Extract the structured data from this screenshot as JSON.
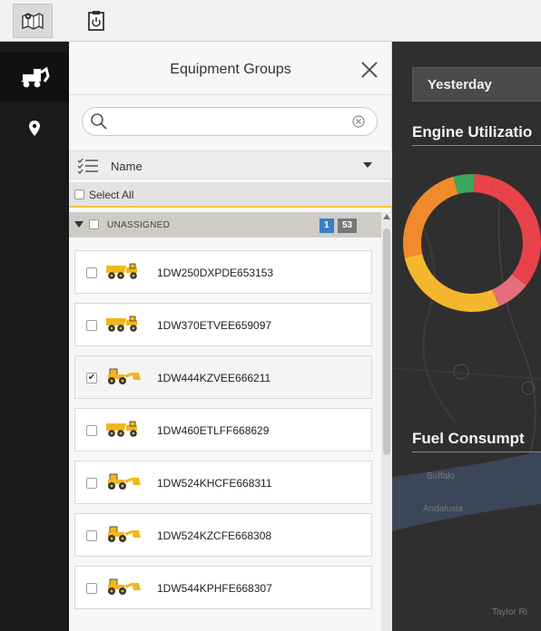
{
  "toolbar": {
    "items": [
      {
        "icon": "map-icon",
        "active": true
      },
      {
        "icon": "report-icon",
        "active": false
      }
    ]
  },
  "leftnav": {
    "items": [
      {
        "icon": "equipment-icon",
        "active": true
      },
      {
        "icon": "location-pin-icon",
        "active": false
      }
    ]
  },
  "panel": {
    "title": "Equipment Groups",
    "search": {
      "value": "",
      "placeholder": ""
    },
    "sort": {
      "label": "Name"
    },
    "select_all": {
      "label": "Select All"
    },
    "group": {
      "label": "UNASSIGNED",
      "selected_count": "1",
      "total_count": "53"
    },
    "items": [
      {
        "serial": "1DW250DXPDE653153",
        "checked": false,
        "icon": "dump-truck-icon"
      },
      {
        "serial": "1DW370ETVEE659097",
        "checked": false,
        "icon": "dump-truck-icon"
      },
      {
        "serial": "1DW444KZVEE666211",
        "checked": true,
        "icon": "wheel-loader-icon"
      },
      {
        "serial": "1DW460ETLFF668629",
        "checked": false,
        "icon": "dump-truck-icon"
      },
      {
        "serial": "1DW524KHCFE668311",
        "checked": false,
        "icon": "wheel-loader-icon"
      },
      {
        "serial": "1DW524KZCFE668308",
        "checked": false,
        "icon": "wheel-loader-icon"
      },
      {
        "serial": "1DW544KPHFE668307",
        "checked": false,
        "icon": "wheel-loader-icon"
      }
    ]
  },
  "dashboard": {
    "date_range": "Yesterday",
    "engine_title": "Engine Utilizatio",
    "fuel_title": "Fuel Consumpt",
    "map_labels": [
      "Buffalo",
      "Andalusia",
      "Taylor Ri"
    ],
    "donut_segments": [
      {
        "color": "#e8434a",
        "fraction": 0.3
      },
      {
        "color": "#e56d7d",
        "fraction": 0.08
      },
      {
        "color": "#f4b82e",
        "fraction": 0.28
      },
      {
        "color": "#f08a2c",
        "fraction": 0.24
      },
      {
        "color": "#3aa85a",
        "fraction": 0.05
      },
      {
        "color": "#e8434a",
        "fraction": 0.05
      }
    ]
  },
  "colors": {
    "accent_yellow": "#f0c840",
    "badge_blue": "#3c7fc4",
    "badge_gray": "#777777",
    "equipment_yellow": "#f2b71d"
  }
}
